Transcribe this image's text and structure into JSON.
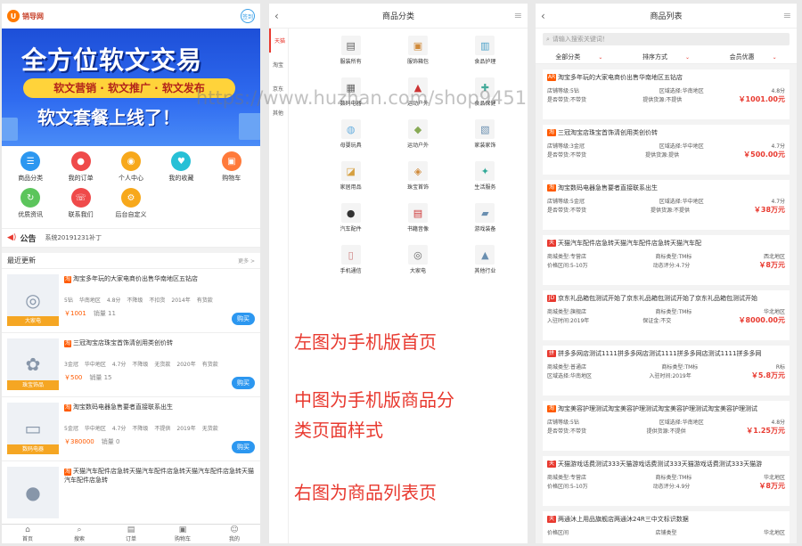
{
  "phone1": {
    "logo": "销导网",
    "sign": "签到",
    "banner": {
      "title": "全方位软文交易",
      "pill": "软文营销 · 软文推广 · 软文发布",
      "sub": "软文套餐上线了！"
    },
    "icons": [
      {
        "label": "商品分类",
        "color": "#2c97f0",
        "glyph": "☰"
      },
      {
        "label": "我的订单",
        "color": "#ef4a4a",
        "glyph": "●"
      },
      {
        "label": "个人中心",
        "color": "#f7a81b",
        "glyph": "◉"
      },
      {
        "label": "我的收藏",
        "color": "#27c0d6",
        "glyph": "♥"
      },
      {
        "label": "购物车",
        "color": "#ff7a3a",
        "glyph": "▣"
      },
      {
        "label": "优质资讯",
        "color": "#5cc55c",
        "glyph": "↻"
      },
      {
        "label": "联系我们",
        "color": "#ef4a4a",
        "glyph": "☏"
      },
      {
        "label": "后台自定义",
        "color": "#f7a81b",
        "glyph": "⚙"
      }
    ],
    "notice": {
      "tag": "公告",
      "msg": "系统20191231补丁"
    },
    "latest": {
      "title": "最近更新",
      "more": "更多 >"
    },
    "items": [
      {
        "thumb": "大家电",
        "glyph": "◎",
        "title": "淘宝多年玩的大家电商价出售华南地区五钻店",
        "meta": [
          "5钻",
          "华南地区",
          "4.8分",
          "不降级",
          "不扣货",
          "2014年",
          "有货款"
        ],
        "price": "￥1001",
        "sale": "销量 11",
        "buy": "购买"
      },
      {
        "thumb": "珠宝饰品",
        "glyph": "✿",
        "title": "三冠淘宝店珠宝首饰清创用类创价转",
        "meta": [
          "3金冠",
          "华中地区",
          "4.7分",
          "不降级",
          "无货款",
          "2020年",
          "有货款"
        ],
        "price": "￥500",
        "sale": "销量 15",
        "buy": "购买"
      },
      {
        "thumb": "数码电器",
        "glyph": "▭",
        "title": "淘宝数码电器急售要者直接联系出生",
        "meta": [
          "5金冠",
          "华中地区",
          "4.7分",
          "不降级",
          "不提供",
          "2019年",
          "无货款"
        ],
        "price": "￥380000",
        "sale": "销量 0",
        "buy": "购买"
      },
      {
        "thumb": "",
        "glyph": "●",
        "title": "天猫汽车配件店急转天猫汽车配件店急转天猫汽车配件店急转天猫汽车配件店急转",
        "meta": [],
        "price": "",
        "sale": "",
        "buy": ""
      }
    ],
    "tabs": [
      "首页",
      "搜索",
      "订单",
      "购物车",
      "我的"
    ]
  },
  "phone2": {
    "title": "商品分类",
    "side": [
      "天猫",
      "淘宝",
      "京东",
      "其他"
    ],
    "cats": [
      {
        "label": "服装所有",
        "glyph": "▤",
        "color": "#666"
      },
      {
        "label": "服饰箱包",
        "glyph": "▣",
        "color": "#d08a3a"
      },
      {
        "label": "食品护理",
        "glyph": "▥",
        "color": "#4aa0c8"
      },
      {
        "label": "数码电器",
        "glyph": "▦",
        "color": "#666"
      },
      {
        "label": "运动户外",
        "glyph": "▲",
        "color": "#c33"
      },
      {
        "label": "食品保健",
        "glyph": "✚",
        "color": "#4a9"
      },
      {
        "label": "母婴玩具",
        "glyph": "◍",
        "color": "#6ab0e0"
      },
      {
        "label": "运动户外",
        "glyph": "◆",
        "color": "#8a5"
      },
      {
        "label": "家装家饰",
        "glyph": "▧",
        "color": "#6a8fb0"
      },
      {
        "label": "家居用品",
        "glyph": "◪",
        "color": "#d6a040"
      },
      {
        "label": "珠宝首饰",
        "glyph": "◈",
        "color": "#d08a3a"
      },
      {
        "label": "生活服务",
        "glyph": "✦",
        "color": "#3a9"
      },
      {
        "label": "汽车配件",
        "glyph": "●",
        "color": "#333"
      },
      {
        "label": "书籍音像",
        "glyph": "▤",
        "color": "#c33"
      },
      {
        "label": "游戏装备",
        "glyph": "▰",
        "color": "#6a8fb0"
      },
      {
        "label": "手机通信",
        "glyph": "▯",
        "color": "#c77"
      },
      {
        "label": "大家电",
        "glyph": "◎",
        "color": "#666"
      },
      {
        "label": "其他行业",
        "glyph": "▲",
        "color": "#6a8fb0"
      }
    ]
  },
  "captions": [
    "左图为手机版首页",
    "中图为手机版商品分",
    "类页面样式",
    "右图为商品列表页"
  ],
  "watermark": "https://www.huzhan.com/shop9451",
  "phone3": {
    "title": "商品列表",
    "search": "请输入搜索关键词！",
    "filters": [
      "全部分类",
      "排序方式",
      "会员优惠"
    ],
    "cards": [
      {
        "badge": "AR",
        "bcolor": "#ff5a00",
        "title": "淘宝多年玩的大家电商价出售华南地区五钻店",
        "r1": [
          "店铺等级:5钻",
          "区域选择:华南地区",
          "4.8分"
        ],
        "r2": [
          "是否带货:不带货",
          "提供货源:不提供",
          "￥1001.00元"
        ]
      },
      {
        "badge": "淘",
        "bcolor": "#ff5a00",
        "title": "三冠淘宝店珠宝首饰清创用类创价转",
        "r1": [
          "店铺等级:3金冠",
          "区域选择:华中地区",
          "4.7分"
        ],
        "r2": [
          "是否带货:不带货",
          "提供货源:提供",
          "￥500.00元"
        ]
      },
      {
        "badge": "淘",
        "bcolor": "#ff5a00",
        "title": "淘宝数码电器急售要者直接联系出生",
        "r1": [
          "店铺等级:5金冠",
          "区域选择:华中地区",
          "4.7分"
        ],
        "r2": [
          "是否带货:不带货",
          "提供货源:不提供",
          "￥38万元"
        ]
      },
      {
        "badge": "天",
        "bcolor": "#e8392f",
        "title": "天猫汽车配件店急转天猫汽车配件店急转天猫汽车配",
        "r1": [
          "商城类型:专营店",
          "商标类型:TM标",
          "西北地区"
        ],
        "r2": [
          "价格区间:5-10万",
          "动态评分:4.7分",
          "￥8万元"
        ]
      },
      {
        "badge": "JD",
        "bcolor": "#e8392f",
        "title": "京东礼品箱包测试开始了京东礼品箱包测试开始了京东礼品箱包测试开始",
        "r1": [
          "商城类型:旗舰店",
          "商标类型:TM标",
          "华北地区"
        ],
        "r2": [
          "入驻时间:2019年",
          "保证金:不交",
          "￥8000.00元"
        ]
      },
      {
        "badge": "拼",
        "bcolor": "#e8392f",
        "title": "拼多多网店测试1111拼多多网店测试1111拼多多网店测试1111拼多多网",
        "r1": [
          "商城类型:普通店",
          "商标类型:TM标",
          "R标"
        ],
        "r2": [
          "区域选择:华南地区",
          "入驻时间:2019年",
          "￥5.8万元"
        ]
      },
      {
        "badge": "淘",
        "bcolor": "#ff5a00",
        "title": "淘宝美容护理测试淘宝美容护理测试淘宝美容护理测试淘宝美容护理测试",
        "r1": [
          "店铺等级:5钻",
          "区域选择:华南地区",
          "4.8分"
        ],
        "r2": [
          "是否带货:不带货",
          "提供货源:不提供",
          "￥1.25万元"
        ]
      },
      {
        "badge": "天",
        "bcolor": "#e8392f",
        "title": "天猫游戏话费测试333天猫游戏话费测试333天猫游戏话费测试333天猫游",
        "r1": [
          "商城类型:专营店",
          "商标类型:TM标",
          "华北地区"
        ],
        "r2": [
          "价格区间:5-10万",
          "动态评分:4.9分",
          "￥8万元"
        ]
      },
      {
        "badge": "天",
        "bcolor": "#e8392f",
        "title": "两通沐上用品旗舰店两通沐24R三中文标识数据",
        "r1": [
          "价格区间",
          "店铺类型",
          "华北地区"
        ],
        "r2": [
          "",
          "",
          ""
        ]
      }
    ]
  }
}
